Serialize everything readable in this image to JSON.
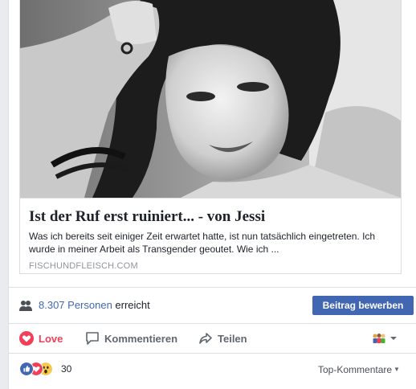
{
  "link_preview": {
    "title": "Ist der Ruf erst ruiniert... - von Jessi",
    "description": "Was ich bereits seit einiger Zeit erwartet hatte, ist nun tatsächlich eingetreten. Ich wurde in meiner Arbeit als Transgender geoutet. Wie ich ...",
    "domain": "FISCHUNDFLEISCH.COM"
  },
  "reach": {
    "count_label": "8.307 Personen",
    "suffix": "erreicht",
    "boost_label": "Beitrag bewerben"
  },
  "actions": {
    "love_label": "Love",
    "comment_label": "Kommentieren",
    "share_label": "Teilen"
  },
  "reactions": {
    "count": "30",
    "sort_label": "Top-Kommentare"
  },
  "colors": {
    "brand_blue": "#4267b2",
    "love_red": "#f33e58",
    "muted_text": "#616770"
  },
  "icons": [
    "people-icon",
    "heart-icon",
    "comment-icon",
    "share-icon",
    "audience-icon",
    "like-reaction-icon",
    "love-reaction-icon",
    "wow-reaction-icon"
  ]
}
